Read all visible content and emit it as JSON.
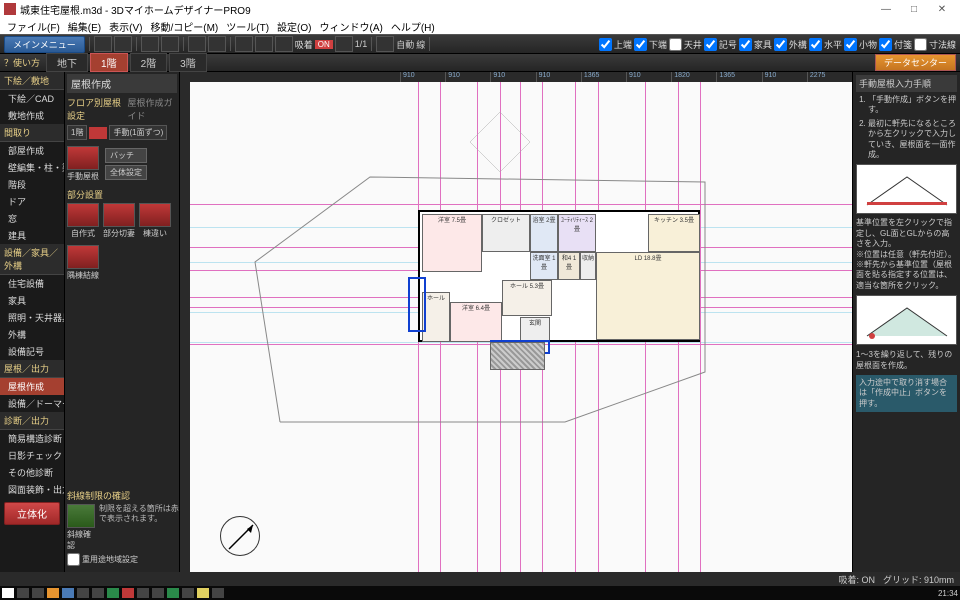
{
  "title": "城東住宅屋根.m3d - 3DマイホームデザイナーPRO9",
  "menu": [
    "ファイル(F)",
    "編集(E)",
    "表示(V)",
    "移動/コピー(M)",
    "ツール(T)",
    "設定(O)",
    "ウィンドウ(A)",
    "ヘルプ(H)"
  ],
  "toolbar1": {
    "mainbtn": "メインメニュー",
    "snap_label": "吸着",
    "snap_on": "ON",
    "ratio": "1/1",
    "auto": "自動",
    "line": "線",
    "checks": [
      "上端",
      "下端",
      "天井",
      "記号",
      "家具",
      "外構",
      "水平",
      "小物",
      "付箋",
      "寸法線"
    ]
  },
  "toolbar2": {
    "usage": "？使い方",
    "tabs": [
      "地下",
      "1階",
      "2階",
      "3階"
    ],
    "active_tab": 1,
    "datacenter": "データセンター"
  },
  "leftnav": {
    "groups": [
      {
        "title": "下絵／敷地",
        "items": [
          "下絵／CAD",
          "敷地作成"
        ]
      },
      {
        "title": "間取り",
        "items": [
          "部屋作成",
          "壁編集・柱・梁",
          "階段",
          "ドア",
          "窓",
          "建具"
        ]
      },
      {
        "title": "設備／家具／外構",
        "items": [
          "住宅設備",
          "家具",
          "照明・天井器具",
          "外構",
          "設備記号"
        ]
      },
      {
        "title": "屋根／出力",
        "items": [
          "屋根作成",
          "設備／ドーマー"
        ]
      },
      {
        "title": "診断／出力",
        "items": [
          "簡易構造診断",
          "日影チェック",
          "その他診断",
          "図面装飾・出力"
        ]
      }
    ],
    "active": "屋根作成",
    "redbtn": "立体化"
  },
  "toolpanel": {
    "header": "屋根作成",
    "tab1": "フロア別屋根設定",
    "tab2": "屋根作成ガイド",
    "floor": "1階",
    "manual_btn": "手動(1面ずつ)",
    "manual_roof": "手動屋根",
    "batch": "バッチ",
    "all_settings": "全体設定",
    "section_partial": "部分設置",
    "partial_items": [
      "自作式",
      "部分切妻",
      "棟違い"
    ],
    "section_complex": "",
    "complex_item": "隅棟結線",
    "bottom_header": "斜線制限の確認",
    "bottom_note": "制限を超える箇所は赤で表示されます。",
    "bottom_label": "斜線確認",
    "bottom_check": "重用途地域設定"
  },
  "ruler_ticks": [
    "910",
    "910",
    "910",
    "910",
    "1365",
    "910",
    "1820",
    "1365",
    "910",
    "2275"
  ],
  "rooms": {
    "r1": "洋室\n7.5畳",
    "r2": "クロゼット",
    "r3": "浴室\n2畳",
    "r4": "ﾕｰﾃｨﾘﾃｨｰｽ\n2畳",
    "r5": "キッチン\n3.5畳",
    "r6": "洗面室\n1畳",
    "r7": "LD\n18.8畳",
    "r8": "洋室\n6.4畳",
    "r9": "和4\n1畳",
    "r10": "玄関",
    "r11": "ホール",
    "r12": "ホール\n5.3畳",
    "r13": "収納"
  },
  "rightpanel": {
    "header": "手動屋根入力手順",
    "steps": [
      "「手動作成」ボタンを押す。",
      "最初に軒先になるところから左クリックで入力していき、屋根面を一面作成。"
    ],
    "note1": "基準位置を左クリックで指定し、GL面とGLからの高さを入力。\n※位置は任意（軒先付近）。\n※軒先から基準位置（屋根面を貼る指定する位置は、適当な箇所をクリック。",
    "step3": "1～3を繰り返して、残りの屋根面を作成。",
    "cancel": "入力途中で取り消す場合は「作成中止」ボタンを押す。"
  },
  "statusbar": {
    "snap": "吸着: ON",
    "grid": "グリッド: 910mm"
  },
  "taskbar": {
    "time": "21:34"
  }
}
